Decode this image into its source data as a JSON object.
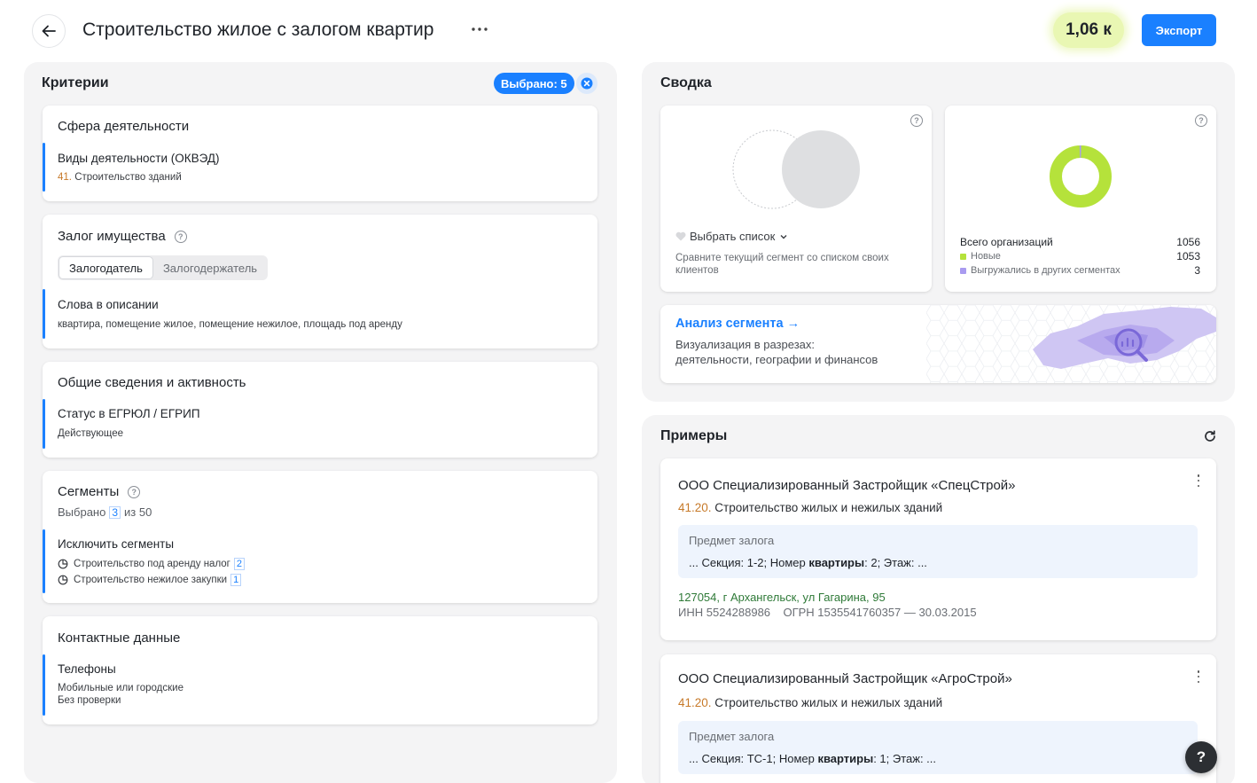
{
  "header": {
    "title": "Строительство жилое с залогом квартир",
    "count": "1,06 к",
    "export_label": "Экспорт"
  },
  "criteria": {
    "title": "Критерии",
    "selected_label": "Выбрано: 5",
    "activity": {
      "title": "Сфера деятельности",
      "sub_title": "Виды деятельности (ОКВЭД)",
      "code": "41.",
      "value": " Строительство зданий"
    },
    "pledge": {
      "title": "Залог имущества",
      "tabs": [
        "Залогодатель",
        "Залогодержатель"
      ],
      "words_title": "Слова в описании",
      "words_value": "квартира, помещение жилое, помещение нежилое, площадь под аренду"
    },
    "general": {
      "title": "Общие сведения и активность",
      "sub_title": "Статус в ЕГРЮЛ / ЕГРИП",
      "value": "Действующее"
    },
    "segments": {
      "title": "Сегменты",
      "selected_prefix": "Выбрано",
      "selected_count": "3",
      "selected_suffix": "из 50",
      "exclude_title": "Исключить сегменты",
      "items": [
        {
          "label": "Строительство под аренду налог",
          "count": "2"
        },
        {
          "label": "Строительство нежилое закупки",
          "count": "1"
        }
      ]
    },
    "contacts": {
      "title": "Контактные данные",
      "sub_title": "Телефоны",
      "line1": "Мобильные или городские",
      "line2": "Без проверки"
    }
  },
  "summary": {
    "title": "Сводка",
    "compare": {
      "select_label": "Выбрать список",
      "description": "Сравните текущий сегмент со списком своих клиентов"
    },
    "totals": {
      "total_label": "Всего организаций",
      "total_value": "1056",
      "new_label": "Новые",
      "new_value": "1053",
      "exported_label": "Выгружались в других сегментах",
      "exported_value": "3",
      "new_color": "#b5e23b",
      "exported_color": "#a99bf0"
    },
    "analysis": {
      "link": "Анализ сегмента →",
      "desc_line1": "Визуализация в разрезах:",
      "desc_line2": "деятельности, географии и финансов"
    }
  },
  "examples": {
    "title": "Примеры",
    "items": [
      {
        "name": "ООО Специализированный Застройщик «СпецСтрой»",
        "code": "41.20.",
        "okved": " Строительство жилых и нежилых зданий",
        "pledge_label": "Предмет залога",
        "pledge_before": "... Секция: 1-2; Номер ",
        "pledge_bold": "квартиры",
        "pledge_after": ": 2; Этаж: ...",
        "address": "127054, г Архангельск,  ул Гагарина, 95",
        "ids": "ИНН 5524288986    ОГРН 1535541760357 — 30.03.2015"
      },
      {
        "name": "ООО Специализированный Застройщик «АгроСтрой»",
        "code": "41.20.",
        "okved": " Строительство жилых и нежилых зданий",
        "pledge_label": "Предмет залога",
        "pledge_before": "... Секция: ТС-1; Номер ",
        "pledge_bold": "квартиры",
        "pledge_after": ": 1; Этаж: ..."
      }
    ]
  },
  "help_fab": "?"
}
